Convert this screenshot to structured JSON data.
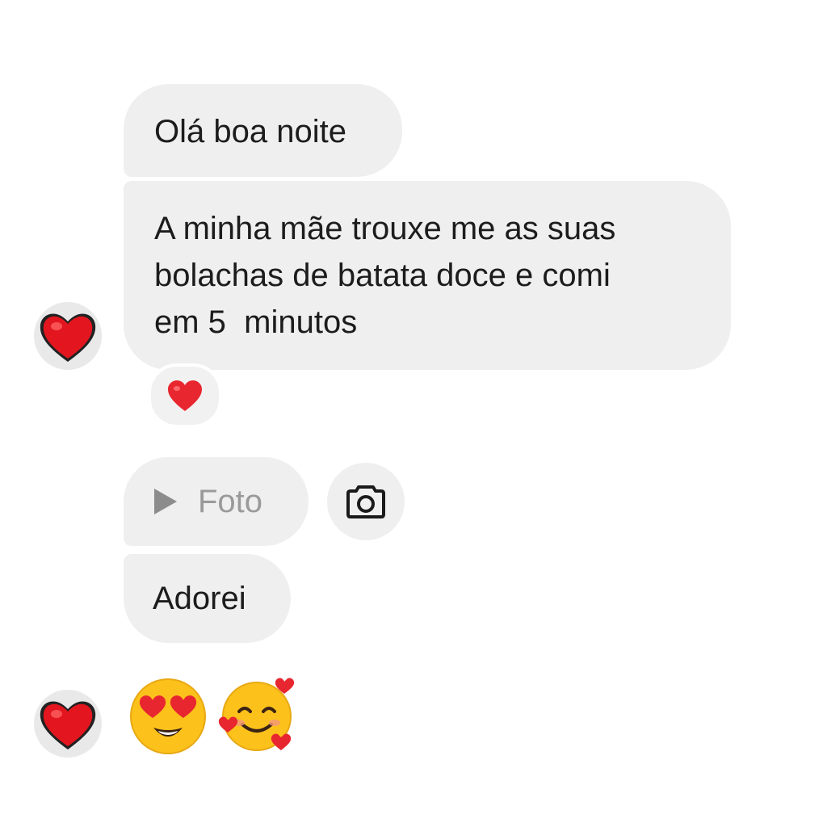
{
  "messages": [
    {
      "text": "Olá boa noite"
    },
    {
      "lines": [
        "A minha mãe trouxe me as suas",
        "bolachas de batata doce e comi",
        "em 5  minutos"
      ]
    },
    {
      "label": "Foto"
    },
    {
      "text": "Adorei"
    }
  ],
  "reactions": {
    "message_2": "red-heart"
  },
  "emojis": [
    "smiling-face-with-heart-eyes",
    "smiling-face-with-hearts"
  ],
  "colors": {
    "bubble": "#efefef",
    "heart": "#e8262f",
    "emoji_yellow": "#fcc21b",
    "muted_text": "#9a9a9a"
  }
}
